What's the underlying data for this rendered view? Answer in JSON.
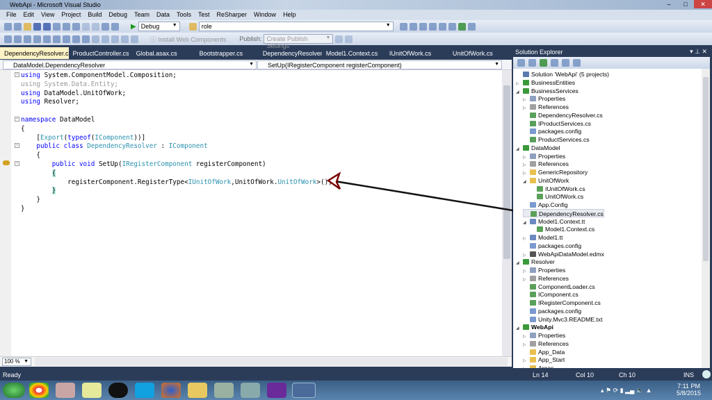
{
  "window": {
    "title": "WebApi - Microsoft Visual Studio"
  },
  "menu": [
    "File",
    "Edit",
    "View",
    "Project",
    "Build",
    "Debug",
    "Team",
    "Data",
    "Tools",
    "Test",
    "ReSharper",
    "Window",
    "Help"
  ],
  "toolbar": {
    "config": "Debug",
    "find": "role",
    "install_web_components": "Install Web Components",
    "publish_label": "Publish:",
    "publish_value": "Create Publish Settings"
  },
  "tabs": [
    "DependencyResolver.cs",
    "ProductController.cs",
    "Global.asax.cs",
    "Bootstrapper.cs",
    "DependencyResolver.cs",
    "Model1.Context.cs",
    "IUnitOfWork.cs",
    "UnitOfWork.cs"
  ],
  "active_tab_close": "×",
  "nav": {
    "type": "DataModel.DependencyResolver",
    "member": "SetUp(IRegisterComponent registerComponent)"
  },
  "code": [
    [
      [
        "using ",
        "kw"
      ],
      [
        "System.ComponentModel.Composition;",
        "pl"
      ]
    ],
    [
      [
        "using System.Data.Entity;",
        "gr"
      ]
    ],
    [
      [
        "using ",
        "kw"
      ],
      [
        "DataModel.UnitOfWork;",
        "pl"
      ]
    ],
    [
      [
        "using ",
        "kw"
      ],
      [
        "Resolver;",
        "pl"
      ]
    ],
    [],
    [
      [
        "namespace ",
        "kw"
      ],
      [
        "DataModel",
        "pl"
      ]
    ],
    [
      [
        "{",
        "pl"
      ]
    ],
    [
      [
        "    [",
        "pl"
      ],
      [
        "Export",
        "ty"
      ],
      [
        "(",
        "pl"
      ],
      [
        "typeof",
        "kw"
      ],
      [
        "(",
        "pl"
      ],
      [
        "IComponent",
        "ty"
      ],
      [
        "))]",
        "pl"
      ]
    ],
    [
      [
        "    public class ",
        "kw"
      ],
      [
        "DependencyResolver",
        "ty"
      ],
      [
        " : ",
        "pl"
      ],
      [
        "IComponent",
        "ty"
      ]
    ],
    [
      [
        "    {",
        "pl"
      ]
    ],
    [
      [
        "        public void ",
        "kw"
      ],
      [
        "SetUp(",
        "pl"
      ],
      [
        "IRegisterComponent",
        "ty"
      ],
      [
        " registerComponent)",
        "pl"
      ]
    ],
    [
      [
        "        ",
        "pl"
      ],
      [
        "{",
        "br"
      ]
    ],
    [
      [
        "            registerComponent.RegisterType<",
        "pl"
      ],
      [
        "IUnitOfWork",
        "ty"
      ],
      [
        ",UnitOfWork.",
        "pl"
      ],
      [
        "UnitOfWork",
        "ty"
      ],
      [
        ">();",
        "pl"
      ]
    ],
    [
      [
        "        ",
        "pl"
      ],
      [
        "}",
        "br"
      ]
    ],
    [
      [
        "    }",
        "pl"
      ]
    ],
    [
      [
        "}",
        "pl"
      ]
    ]
  ],
  "zoom": "100 %",
  "solution_explorer": {
    "title": "Solution Explorer",
    "items": [
      {
        "d": 0,
        "label": "Solution 'WebApi' (5 projects)",
        "icon": "solution",
        "ex": ""
      },
      {
        "d": 0,
        "label": "BusinessEntities",
        "icon": "project",
        "ex": "▷"
      },
      {
        "d": 0,
        "label": "BusinessServices",
        "icon": "project",
        "ex": "◢"
      },
      {
        "d": 1,
        "label": "Properties",
        "icon": "properties",
        "ex": "▷"
      },
      {
        "d": 1,
        "label": "References",
        "icon": "references",
        "ex": "▷"
      },
      {
        "d": 1,
        "label": "DependencyResolver.cs",
        "icon": "cs-file",
        "ex": ""
      },
      {
        "d": 1,
        "label": "IProductServices.cs",
        "icon": "cs-file",
        "ex": ""
      },
      {
        "d": 1,
        "label": "packages.config",
        "icon": "config-file",
        "ex": ""
      },
      {
        "d": 1,
        "label": "ProductServices.cs",
        "icon": "cs-file",
        "ex": ""
      },
      {
        "d": 0,
        "label": "DataModel",
        "icon": "project",
        "ex": "◢"
      },
      {
        "d": 1,
        "label": "Properties",
        "icon": "properties",
        "ex": "▷"
      },
      {
        "d": 1,
        "label": "References",
        "icon": "references",
        "ex": "▷"
      },
      {
        "d": 1,
        "label": "GenericRepository",
        "icon": "folder",
        "ex": "▷"
      },
      {
        "d": 1,
        "label": "UnitOfWork",
        "icon": "folder-open",
        "ex": "◢"
      },
      {
        "d": 2,
        "label": "IUnitOfWork.cs",
        "icon": "cs-file",
        "ex": ""
      },
      {
        "d": 2,
        "label": "UnitOfWork.cs",
        "icon": "cs-file",
        "ex": ""
      },
      {
        "d": 1,
        "label": "App.Config",
        "icon": "config-file",
        "ex": ""
      },
      {
        "d": 1,
        "label": "DependencyResolver.cs",
        "icon": "cs-file",
        "ex": "",
        "selected": true
      },
      {
        "d": 1,
        "label": "Model1.Context.tt",
        "icon": "tt-file",
        "ex": "◢"
      },
      {
        "d": 2,
        "label": "Model1.Context.cs",
        "icon": "cs-file",
        "ex": ""
      },
      {
        "d": 1,
        "label": "Model1.tt",
        "icon": "tt-file",
        "ex": "▷"
      },
      {
        "d": 1,
        "label": "packages.config",
        "icon": "config-file",
        "ex": ""
      },
      {
        "d": 1,
        "label": "WebApiDataModel.edmx",
        "icon": "edmx-file",
        "ex": "▷"
      },
      {
        "d": 0,
        "label": "Resolver",
        "icon": "project",
        "ex": "◢"
      },
      {
        "d": 1,
        "label": "Properties",
        "icon": "properties",
        "ex": "▷"
      },
      {
        "d": 1,
        "label": "References",
        "icon": "references",
        "ex": "▷"
      },
      {
        "d": 1,
        "label": "ComponentLoader.cs",
        "icon": "cs-file",
        "ex": ""
      },
      {
        "d": 1,
        "label": "IComponent.cs",
        "icon": "cs-file",
        "ex": ""
      },
      {
        "d": 1,
        "label": "IRegisterComponent.cs",
        "icon": "cs-file",
        "ex": ""
      },
      {
        "d": 1,
        "label": "packages.config",
        "icon": "config-file",
        "ex": ""
      },
      {
        "d": 1,
        "label": "Unity.Mvc3.README.txt",
        "icon": "txt-file",
        "ex": ""
      },
      {
        "d": 0,
        "label": "WebApi",
        "icon": "web-project",
        "ex": "◢",
        "bold": true
      },
      {
        "d": 1,
        "label": "Properties",
        "icon": "properties",
        "ex": "▷"
      },
      {
        "d": 1,
        "label": "References",
        "icon": "references",
        "ex": "▷"
      },
      {
        "d": 1,
        "label": "App_Data",
        "icon": "folder",
        "ex": ""
      },
      {
        "d": 1,
        "label": "App_Start",
        "icon": "folder",
        "ex": "▷"
      },
      {
        "d": 1,
        "label": "Areas",
        "icon": "folder",
        "ex": "▷"
      }
    ]
  },
  "status": {
    "ready": "Ready",
    "ln": "Ln 14",
    "col": "Col 10",
    "ch": "Ch 10",
    "mode": "INS"
  },
  "clock": {
    "time": "7:11 PM",
    "date": "5/8/2015"
  },
  "colors": {
    "accent": "#2b3c59",
    "arrow": "#7a0000",
    "active_tab": "#fff3c6"
  }
}
